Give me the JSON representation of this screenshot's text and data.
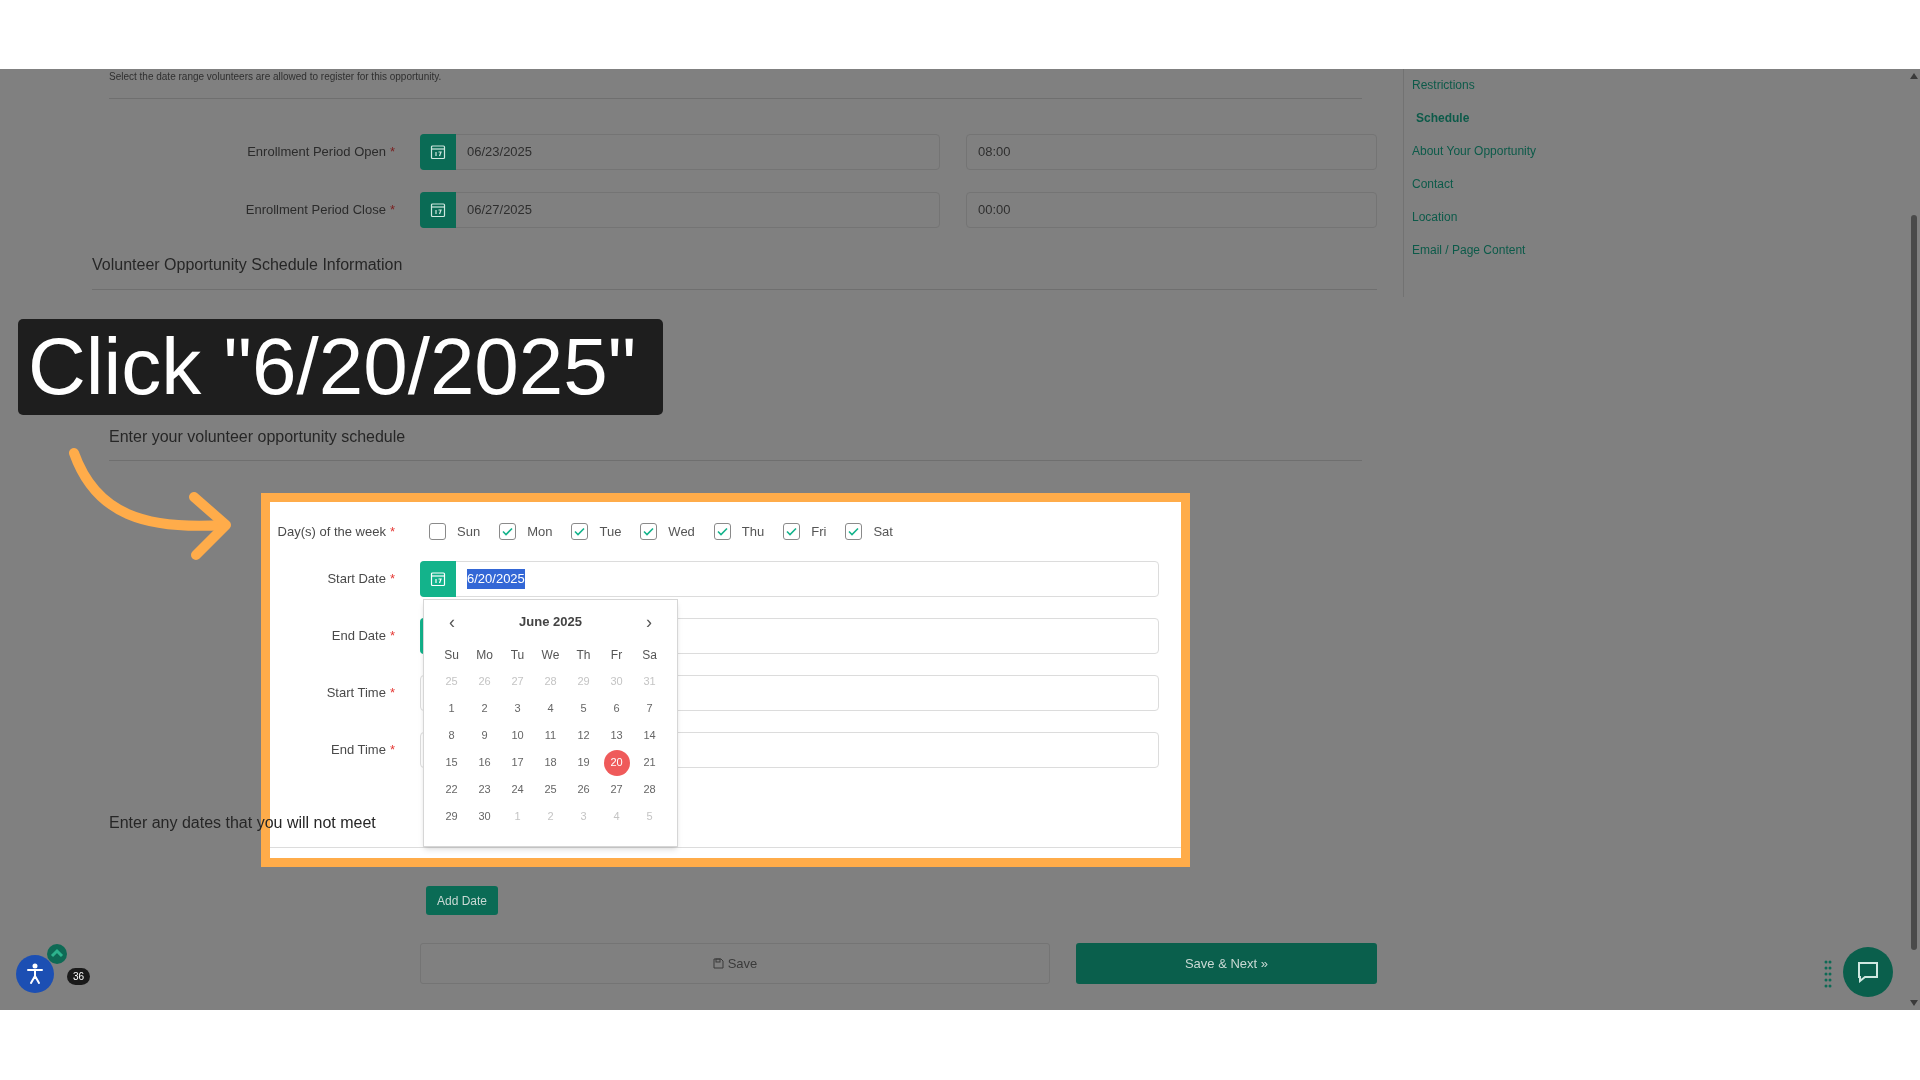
{
  "enrollment": {
    "hint": "Select the date range volunteers are allowed to register for this opportunity.",
    "rows": [
      {
        "label": "Enrollment Period Open",
        "required": "*",
        "date": "06/23/2025",
        "time": "08:00"
      },
      {
        "label": "Enrollment Period Close",
        "required": "*",
        "date": "06/27/2025",
        "time": "00:00"
      }
    ]
  },
  "schedule_heading": "Volunteer Opportunity Schedule Information",
  "callout": {
    "text": "Click \"6/20/2025\""
  },
  "schedule_subheading": "Enter your volunteer opportunity schedule",
  "weekdays": {
    "label": "Day(s) of the week",
    "required": "*",
    "days": [
      {
        "label": "Sun",
        "checked": false
      },
      {
        "label": "Mon",
        "checked": true
      },
      {
        "label": "Tue",
        "checked": true
      },
      {
        "label": "Wed",
        "checked": true
      },
      {
        "label": "Thu",
        "checked": true
      },
      {
        "label": "Fri",
        "checked": true
      },
      {
        "label": "Sat",
        "checked": true
      }
    ]
  },
  "fields": [
    {
      "label": "Start Date",
      "required": "*",
      "value": "6/20/2025",
      "text_selected": true,
      "kind": "date"
    },
    {
      "label": "End Date",
      "required": "*",
      "kind": "date"
    },
    {
      "label": "Start Time",
      "required": "*",
      "kind": "time"
    },
    {
      "label": "End Time",
      "required": "*",
      "kind": "time"
    }
  ],
  "calendar": {
    "month": "June 2025",
    "prev": "‹",
    "next": "›",
    "weekdays": [
      "Su",
      "Mo",
      "Tu",
      "We",
      "Th",
      "Fr",
      "Sa"
    ],
    "days": [
      {
        "label": "25",
        "outside": true,
        "selected": false
      },
      {
        "label": "26",
        "outside": true,
        "selected": false
      },
      {
        "label": "27",
        "outside": true,
        "selected": false
      },
      {
        "label": "28",
        "outside": true,
        "selected": false
      },
      {
        "label": "29",
        "outside": true,
        "selected": false
      },
      {
        "label": "30",
        "outside": true,
        "selected": false
      },
      {
        "label": "31",
        "outside": true,
        "selected": false
      },
      {
        "label": "1",
        "outside": false,
        "selected": false
      },
      {
        "label": "2",
        "outside": false,
        "selected": false
      },
      {
        "label": "3",
        "outside": false,
        "selected": false
      },
      {
        "label": "4",
        "outside": false,
        "selected": false
      },
      {
        "label": "5",
        "outside": false,
        "selected": false
      },
      {
        "label": "6",
        "outside": false,
        "selected": false
      },
      {
        "label": "7",
        "outside": false,
        "selected": false
      },
      {
        "label": "8",
        "outside": false,
        "selected": false
      },
      {
        "label": "9",
        "outside": false,
        "selected": false
      },
      {
        "label": "10",
        "outside": false,
        "selected": false
      },
      {
        "label": "11",
        "outside": false,
        "selected": false
      },
      {
        "label": "12",
        "outside": false,
        "selected": false
      },
      {
        "label": "13",
        "outside": false,
        "selected": false
      },
      {
        "label": "14",
        "outside": false,
        "selected": false
      },
      {
        "label": "15",
        "outside": false,
        "selected": false
      },
      {
        "label": "16",
        "outside": false,
        "selected": false
      },
      {
        "label": "17",
        "outside": false,
        "selected": false
      },
      {
        "label": "18",
        "outside": false,
        "selected": false
      },
      {
        "label": "19",
        "outside": false,
        "selected": false
      },
      {
        "label": "20",
        "outside": false,
        "selected": true
      },
      {
        "label": "21",
        "outside": false,
        "selected": false
      },
      {
        "label": "22",
        "outside": false,
        "selected": false
      },
      {
        "label": "23",
        "outside": false,
        "selected": false
      },
      {
        "label": "24",
        "outside": false,
        "selected": false
      },
      {
        "label": "25",
        "outside": false,
        "selected": false
      },
      {
        "label": "26",
        "outside": false,
        "selected": false
      },
      {
        "label": "27",
        "outside": false,
        "selected": false
      },
      {
        "label": "28",
        "outside": false,
        "selected": false
      },
      {
        "label": "29",
        "outside": false,
        "selected": false
      },
      {
        "label": "30",
        "outside": false,
        "selected": false
      },
      {
        "label": "1",
        "outside": true,
        "selected": false
      },
      {
        "label": "2",
        "outside": true,
        "selected": false
      },
      {
        "label": "3",
        "outside": true,
        "selected": false
      },
      {
        "label": "4",
        "outside": true,
        "selected": false
      },
      {
        "label": "5",
        "outside": true,
        "selected": false
      }
    ]
  },
  "exclusions_heading": "Enter any dates that you will not meet",
  "add_date_button": "Add Date",
  "save_button": "Save",
  "save_next_button": "Save & Next »",
  "sidebar": {
    "items": [
      {
        "label": "Restrictions",
        "selected": false
      },
      {
        "label": "Schedule",
        "selected": true
      },
      {
        "label": "About Your Opportunity",
        "selected": false
      },
      {
        "label": "Contact",
        "selected": false
      },
      {
        "label": "Location",
        "selected": false
      },
      {
        "label": "Email / Page Content",
        "selected": false
      }
    ]
  },
  "accessibility_badge": "36"
}
